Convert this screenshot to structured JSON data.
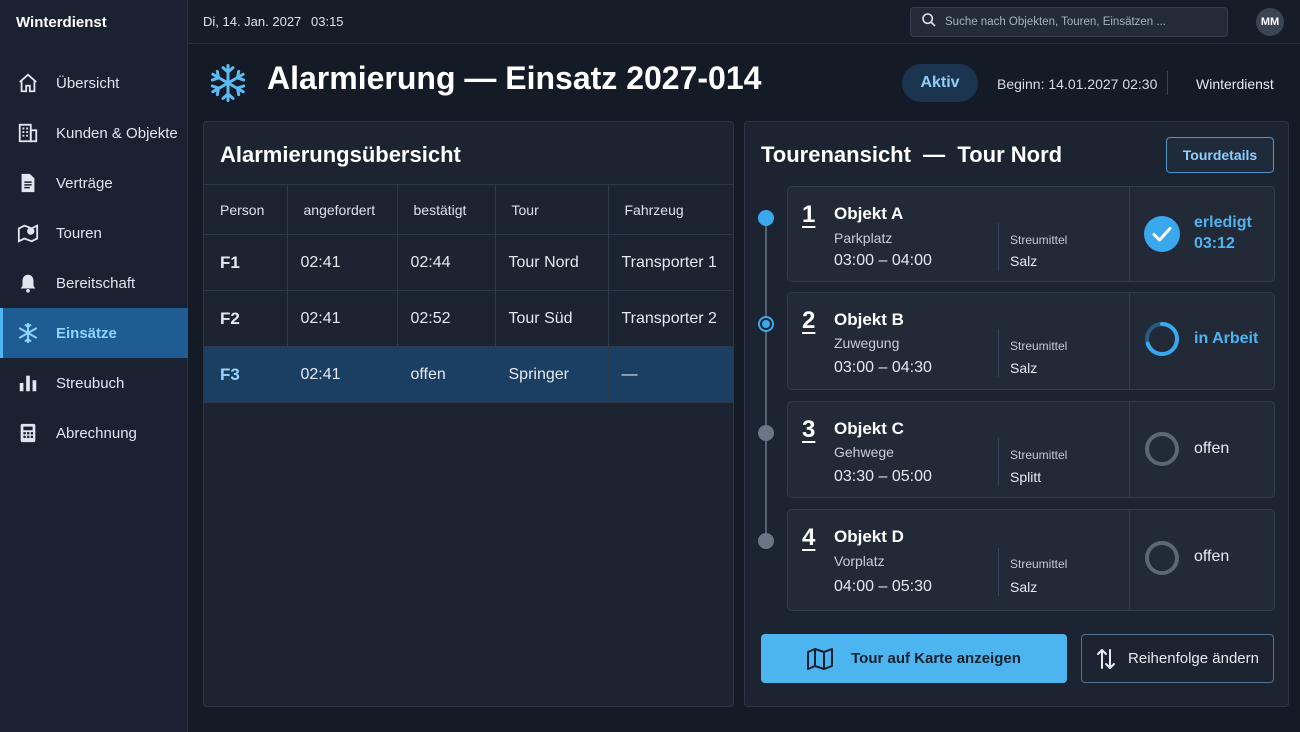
{
  "app": {
    "title": "Winterdienst"
  },
  "topbar": {
    "date": "Di, 14. Jan. 2027",
    "time": "03:15",
    "search_placeholder": "Suche nach Objekten, Touren, Einsätzen ...",
    "user_initials": "MM"
  },
  "sidebar": {
    "items": [
      {
        "label": "Übersicht",
        "icon": "home-icon"
      },
      {
        "label": "Kunden & Objekte",
        "icon": "building-icon"
      },
      {
        "label": "Verträge",
        "icon": "document-icon"
      },
      {
        "label": "Touren",
        "icon": "map-pin-icon"
      },
      {
        "label": "Bereitschaft",
        "icon": "bell-icon"
      },
      {
        "label": "Einsätze",
        "icon": "snowflake-icon",
        "active": true
      },
      {
        "label": "Streubuch",
        "icon": "bar-chart-icon"
      },
      {
        "label": "Abrechnung",
        "icon": "calculator-icon"
      }
    ]
  },
  "header": {
    "title": "Alarmierung — Einsatz 2027-014",
    "status": "Aktiv",
    "start": "Beginn: 14.01.2027 02:30",
    "org": "Winterdienst"
  },
  "alarm": {
    "title": "Alarmierungsübersicht",
    "columns": [
      "Person",
      "angefordert",
      "bestätigt",
      "Tour",
      "Fahrzeug"
    ],
    "rows": [
      [
        "F1",
        "02:41",
        "02:44",
        "Tour Nord",
        "Transporter 1"
      ],
      [
        "F2",
        "02:41",
        "02:52",
        "Tour Süd",
        "Transporter 2"
      ],
      [
        "F3",
        "02:41",
        "offen",
        "Springer",
        "—"
      ]
    ]
  },
  "tour": {
    "title": "Tourenansicht  —  Tour Nord",
    "details_label": "Tourdetails",
    "streumittel_label": "Streumittel",
    "stops": [
      {
        "num": "1",
        "name": "Objekt A",
        "location": "Parkplatz",
        "time": "03:00 – 04:00",
        "material": "Salz",
        "status": "erledigt",
        "status_time": "03:12"
      },
      {
        "num": "2",
        "name": "Objekt B",
        "location": "Zuwegung",
        "time": "03:00 – 04:30",
        "material": "Salz",
        "status": "in Arbeit",
        "progress": 0.7
      },
      {
        "num": "3",
        "name": "Objekt C",
        "location": "Gehwege",
        "time": "03:30 – 05:00",
        "material": "Splitt",
        "status": "offen"
      },
      {
        "num": "4",
        "name": "Objekt D",
        "location": "Vorplatz",
        "time": "04:00 – 05:30",
        "material": "Salz",
        "status": "offen"
      }
    ],
    "map_button": "Tour auf Karte anzeigen",
    "order_button": "Reihenfolge ändern"
  },
  "colors": {
    "accent": "#4cb4ee",
    "active_nav": "#1f5c93",
    "done": "#3aa8ec",
    "open": "#5d6675"
  }
}
